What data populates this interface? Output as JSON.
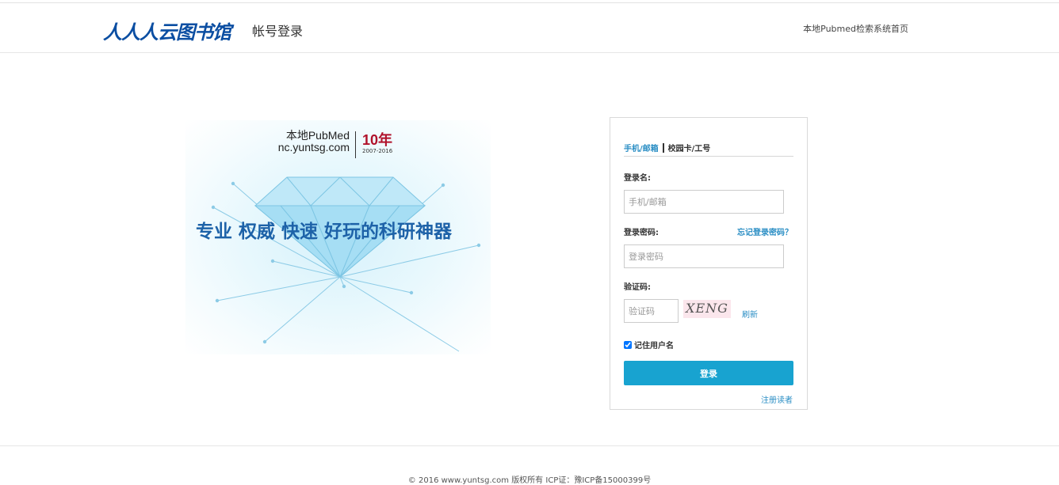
{
  "header": {
    "logo_text": "人人人云图书馆",
    "logo_sub": "帐号登录",
    "home_link": "本地Pubmed检索系统首页"
  },
  "banner": {
    "name_line1": "本地PubMed",
    "name_line2": "nc.yuntsg.com",
    "years": "10年",
    "range": "2007-2016",
    "slogan": "专业 权威 快速 好玩的科研神器"
  },
  "login": {
    "tab_active": "手机/邮箱",
    "tab_other": "校园卡/工号",
    "username_label": "登录名:",
    "username_placeholder": "手机/邮箱",
    "password_label": "登录密码:",
    "forgot_link": "忘记登录密码？",
    "password_placeholder": "登录密码",
    "captcha_label": "验证码:",
    "captcha_placeholder": "验证码",
    "captcha_image_text": "XENG",
    "refresh_link": "刷新",
    "remember_label": "记住用户名",
    "remember_checked": true,
    "submit_label": "登录",
    "register_link": "注册读者"
  },
  "footer": {
    "text": "© 2016 www.yuntsg.com 版权所有 ICP证：豫ICP备15000399号"
  },
  "colors": {
    "accent": "#18a3d0",
    "link": "#2a8ec4",
    "brand": "#0b4ea2",
    "years": "#b0122b"
  }
}
